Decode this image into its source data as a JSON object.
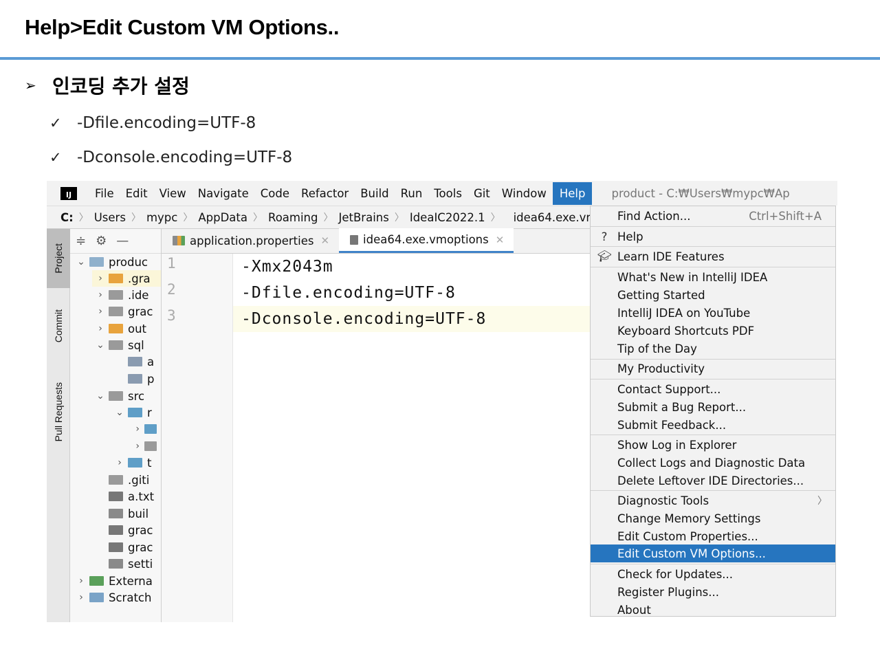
{
  "slide": {
    "title": "Help>Edit Custom VM Options..",
    "bullet_symbol": "➢",
    "bullet": "인코딩 추가 설정",
    "check_symbol": "✓",
    "items": [
      "-Dfile.encoding=UTF-8",
      "-Dconsole.encoding=UTF-8"
    ]
  },
  "ide": {
    "logo": "IJ",
    "menu": [
      "File",
      "Edit",
      "View",
      "Navigate",
      "Code",
      "Refactor",
      "Build",
      "Run",
      "Tools",
      "Git",
      "Window",
      "Help"
    ],
    "active_menu": "Help",
    "window_title": "product - C:₩Users₩mypc₩Ap",
    "breadcrumb": [
      "C:",
      "Users",
      "mypc",
      "AppData",
      "Roaming",
      "JetBrains",
      "IdeaIC2022.1",
      "idea64.exe.vm"
    ],
    "tool_tabs": [
      "Project",
      "Commit",
      "Pull Requests"
    ],
    "project_tree": [
      {
        "label": "produc",
        "chevron": "open"
      },
      {
        "label": ".gra",
        "chevron": "closed"
      },
      {
        "label": ".ide",
        "chevron": "closed"
      },
      {
        "label": "grac",
        "chevron": "closed"
      },
      {
        "label": "out",
        "chevron": "closed"
      },
      {
        "label": "sql",
        "chevron": "open"
      },
      {
        "label": "a",
        "chevron": "none"
      },
      {
        "label": "p",
        "chevron": "none"
      },
      {
        "label": "src",
        "chevron": "open"
      },
      {
        "label": "r",
        "chevron": "open"
      },
      {
        "label": "",
        "chevron": "closed"
      },
      {
        "label": "",
        "chevron": "closed"
      },
      {
        "label": "t",
        "chevron": "closed"
      },
      {
        "label": ".giti",
        "chevron": "none"
      },
      {
        "label": "a.txt",
        "chevron": "none"
      },
      {
        "label": "buil",
        "chevron": "none"
      },
      {
        "label": "grac",
        "chevron": "none"
      },
      {
        "label": "grac",
        "chevron": "none"
      },
      {
        "label": "setti",
        "chevron": "none"
      },
      {
        "label": "Externa",
        "chevron": "closed"
      },
      {
        "label": "Scratch",
        "chevron": "closed"
      }
    ],
    "editor_tabs": [
      "application.properties",
      "idea64.exe.vmoptions"
    ],
    "active_tab": "idea64.exe.vmoptions",
    "code_lines": [
      {
        "num": "1",
        "text": "-Xmx2043m"
      },
      {
        "num": "2",
        "text": "-Dfile.encoding=UTF-8"
      },
      {
        "num": "3",
        "text": "-Dconsole.encoding=UTF-8"
      }
    ],
    "help_menu": {
      "find_action": {
        "label": "Find Action...",
        "shortcut": "Ctrl+Shift+A"
      },
      "help": "Help",
      "learn": "Learn IDE Features",
      "group_resources": [
        "What's New in IntelliJ IDEA",
        "Getting Started",
        "IntelliJ IDEA on YouTube",
        "Keyboard Shortcuts PDF",
        "Tip of the Day"
      ],
      "productivity": "My Productivity",
      "group_support": [
        "Contact Support...",
        "Submit a Bug Report...",
        "Submit Feedback..."
      ],
      "group_logs": [
        "Show Log in Explorer",
        "Collect Logs and Diagnostic Data",
        "Delete Leftover IDE Directories..."
      ],
      "group_tools": [
        "Diagnostic Tools",
        "Change Memory Settings",
        "Edit Custom Properties...",
        "Edit Custom VM Options..."
      ],
      "selected": "Edit Custom VM Options...",
      "group_about": [
        "Check for Updates...",
        "Register Plugins...",
        "About"
      ]
    }
  }
}
